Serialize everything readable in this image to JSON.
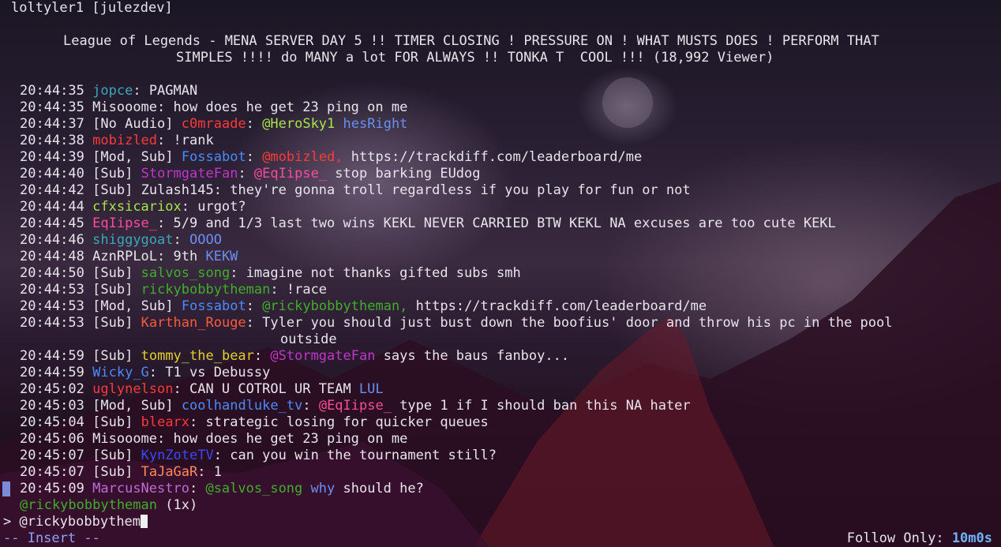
{
  "window": {
    "title": "loltyler1 [julezdev]"
  },
  "stream": {
    "title_line1": "League of Legends - MENA SERVER DAY 5 !! TIMER CLOSING ! PRESSURE ON ! WHAT MUSTS DOES ! PERFORM THAT",
    "title_line2": "SIMPLES !!!! do MANY a lot FOR ALWAYS !! TONKA T  COOL !!! (18,992 Viewer)"
  },
  "colors": {
    "green": "#3fae2a",
    "teal": "#3aa7b9",
    "red": "#ff3a3a",
    "blue": "#4a8bff",
    "purple": "#c236c8",
    "magenta": "#d43cd0",
    "pinkred": "#ff4b64",
    "orange": "#ff5a3c",
    "yellow": "#e3cf2e",
    "darkblue": "#3a48ff",
    "yellowgreen": "#a7e34a",
    "periwinkle": "#6a8ff5",
    "salmon": "#ff8a5a",
    "lilac": "#c06bd6"
  },
  "messages": [
    {
      "ts": "20:44:35",
      "badges": [],
      "user": "jopce",
      "user_color": "#3aa7b9",
      "parts": [
        {
          "t": "PAGMAN"
        }
      ]
    },
    {
      "ts": "20:44:35",
      "badges": [],
      "user": "Misooome",
      "user_color": "#e8e4ec",
      "parts": [
        {
          "t": "how does he get 23 ping on me"
        }
      ]
    },
    {
      "ts": "20:44:37",
      "badges": [
        "No Audio"
      ],
      "user": "c0mraade",
      "user_color": "#ff3a3a",
      "parts": [
        {
          "t": "@HeroSky1",
          "c": "#a7e34a"
        },
        {
          "t": " "
        },
        {
          "t": "hesRight",
          "c": "#6a8ff5"
        }
      ]
    },
    {
      "ts": "20:44:38",
      "badges": [],
      "user": "mobizled",
      "user_color": "#ff3a3a",
      "parts": [
        {
          "t": "!rank"
        }
      ]
    },
    {
      "ts": "20:44:39",
      "badges": [
        "Mod",
        "Sub"
      ],
      "user": "Fossabot",
      "user_color": "#4a8bff",
      "parts": [
        {
          "t": "@mobizled,",
          "c": "#ff3a3a"
        },
        {
          "t": " https://trackdiff.com/leaderboard/me"
        }
      ]
    },
    {
      "ts": "20:44:40",
      "badges": [
        "Sub"
      ],
      "user": "StormgateFan",
      "user_color": "#c236c8",
      "parts": [
        {
          "t": "@EqIipse_",
          "c": "#ff4b9a"
        },
        {
          "t": " stop barking EUdog"
        }
      ]
    },
    {
      "ts": "20:44:42",
      "badges": [
        "Sub"
      ],
      "user": "Zulash145",
      "user_color": "#e8e4ec",
      "parts": [
        {
          "t": "they're gonna troll regardless if you play for fun or not"
        }
      ]
    },
    {
      "ts": "20:44:44",
      "badges": [],
      "user": "cfxsicariox",
      "user_color": "#a7e34a",
      "parts": [
        {
          "t": "urgot?"
        }
      ]
    },
    {
      "ts": "20:44:45",
      "badges": [],
      "user": "EqIipse_",
      "user_color": "#ff4b9a",
      "parts": [
        {
          "t": "5/9 and 1/3 last two wins KEKL NEVER CARRIED BTW KEKL NA excuses are too cute KEKL"
        }
      ]
    },
    {
      "ts": "20:44:46",
      "badges": [],
      "user": "shiggygoat",
      "user_color": "#3aa7b9",
      "parts": [
        {
          "t": "OOOO",
          "c": "#6a8ff5"
        }
      ]
    },
    {
      "ts": "20:44:48",
      "badges": [],
      "user": "AznRPLoL",
      "user_color": "#e8e4ec",
      "parts": [
        {
          "t": "9th "
        },
        {
          "t": "KEKW",
          "c": "#6a8ff5"
        }
      ]
    },
    {
      "ts": "20:44:50",
      "badges": [
        "Sub"
      ],
      "user": "salvos_song",
      "user_color": "#3fae2a",
      "parts": [
        {
          "t": "imagine not thanks gifted subs smh"
        }
      ]
    },
    {
      "ts": "20:44:53",
      "badges": [
        "Sub"
      ],
      "user": "rickybobbytheman",
      "user_color": "#3fae2a",
      "parts": [
        {
          "t": "!race"
        }
      ]
    },
    {
      "ts": "20:44:53",
      "badges": [
        "Mod",
        "Sub"
      ],
      "user": "Fossabot",
      "user_color": "#4a8bff",
      "parts": [
        {
          "t": "@rickybobbytheman,",
          "c": "#3fae2a"
        },
        {
          "t": " https://trackdiff.com/leaderboard/me"
        }
      ]
    },
    {
      "ts": "20:44:53",
      "badges": [
        "Sub"
      ],
      "user": "Karthan_Rouge",
      "user_color": "#ff5a3c",
      "parts": [
        {
          "t": "Tyler you should just bust down the boofius' door and throw his pc in the pool"
        }
      ],
      "cont": "outside"
    },
    {
      "ts": "20:44:59",
      "badges": [
        "Sub"
      ],
      "user": "tommy_the_bear",
      "user_color": "#e3cf2e",
      "parts": [
        {
          "t": "@StormgateFan",
          "c": "#c236c8"
        },
        {
          "t": " says the baus fanboy..."
        }
      ]
    },
    {
      "ts": "20:44:59",
      "badges": [],
      "user": "Wicky_G",
      "user_color": "#4a8bff",
      "parts": [
        {
          "t": "T1 vs Debussy"
        }
      ]
    },
    {
      "ts": "20:45:02",
      "badges": [],
      "user": "uglynelson",
      "user_color": "#ff3a3a",
      "parts": [
        {
          "t": "CAN U COTROL UR TEAM "
        },
        {
          "t": "LUL",
          "c": "#6a8ff5"
        }
      ]
    },
    {
      "ts": "20:45:03",
      "badges": [
        "Mod",
        "Sub"
      ],
      "user": "coolhandluke_tv",
      "user_color": "#4a8bff",
      "parts": [
        {
          "t": "@EqIipse_",
          "c": "#ff4b9a"
        },
        {
          "t": " type 1 if I should ban this NA hater"
        }
      ]
    },
    {
      "ts": "20:45:04",
      "badges": [
        "Sub"
      ],
      "user": "blearx",
      "user_color": "#ff3a3a",
      "parts": [
        {
          "t": "strategic losing for quicker queues"
        }
      ]
    },
    {
      "ts": "20:45:06",
      "badges": [],
      "user": "Misooome",
      "user_color": "#e8e4ec",
      "parts": [
        {
          "t": "how does he get 23 ping on me"
        }
      ]
    },
    {
      "ts": "20:45:07",
      "badges": [
        "Sub"
      ],
      "user": "KynZoteTV",
      "user_color": "#3a48ff",
      "parts": [
        {
          "t": "can you win the tournament still?"
        }
      ]
    },
    {
      "ts": "20:45:07",
      "badges": [
        "Sub"
      ],
      "user": "TaJaGaR",
      "user_color": "#ff8a5a",
      "parts": [
        {
          "t": "1"
        }
      ]
    },
    {
      "ts": "20:45:09",
      "badges": [],
      "user": "MarcusNestro",
      "user_color": "#c06bd6",
      "parts": [
        {
          "t": "@salvos_song",
          "c": "#3fae2a"
        },
        {
          "t": " "
        },
        {
          "t": "why",
          "c": "#6a8ff5"
        },
        {
          "t": " should he?"
        }
      ]
    }
  ],
  "completion": {
    "user": "@rickybobbytheman",
    "count": "(1x)"
  },
  "input": {
    "prompt": ">",
    "value": "@rickybobbythem"
  },
  "status": {
    "mode": "-- Insert --",
    "follow_label": "Follow Only:",
    "follow_value": "10m0s"
  }
}
